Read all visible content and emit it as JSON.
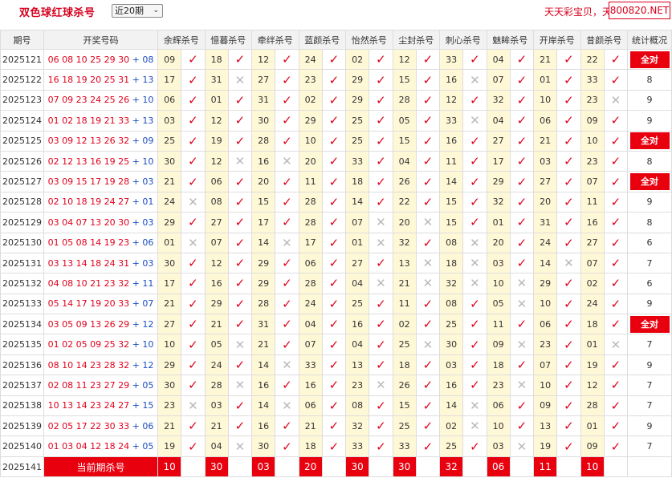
{
  "header": {
    "title": "双色球红球杀号",
    "range_select": "近20期",
    "promo_text": "天天彩宝贝，天",
    "site_badge": "800820.NET"
  },
  "columns": {
    "issue": "期号",
    "draw": "开奖号码",
    "experts": [
      "余辉杀号",
      "憶暮杀号",
      "牵绊杀号",
      "蓝颜杀号",
      "怡然杀号",
      "尘封杀号",
      "刺心杀号",
      "魅眸杀号",
      "开岸杀号",
      "昔颜杀号"
    ],
    "stat": "统计概况"
  },
  "marks": {
    "hit": "✓",
    "miss": "✕"
  },
  "rows": [
    {
      "issue": "2025121",
      "reds": "06 08 10 25 29 30",
      "blue": "08",
      "kills": [
        "09",
        "18",
        "12",
        "24",
        "02",
        "12",
        "33",
        "04",
        "21",
        "22"
      ],
      "hits": [
        1,
        1,
        1,
        1,
        1,
        1,
        1,
        1,
        1,
        1
      ],
      "stat": "全对"
    },
    {
      "issue": "2025122",
      "reds": "16 18 19 20 25 31",
      "blue": "13",
      "kills": [
        "17",
        "31",
        "27",
        "23",
        "29",
        "15",
        "16",
        "07",
        "01",
        "33"
      ],
      "hits": [
        1,
        0,
        1,
        1,
        1,
        1,
        0,
        1,
        1,
        1
      ],
      "stat": "8"
    },
    {
      "issue": "2025123",
      "reds": "07 09 23 24 25 26",
      "blue": "10",
      "kills": [
        "06",
        "01",
        "31",
        "02",
        "29",
        "28",
        "12",
        "32",
        "10",
        "23"
      ],
      "hits": [
        1,
        1,
        1,
        1,
        1,
        1,
        1,
        1,
        1,
        0
      ],
      "stat": "9"
    },
    {
      "issue": "2025124",
      "reds": "01 02 18 19 21 33",
      "blue": "13",
      "kills": [
        "03",
        "12",
        "30",
        "29",
        "25",
        "05",
        "33",
        "04",
        "06",
        "09"
      ],
      "hits": [
        1,
        1,
        1,
        1,
        1,
        1,
        0,
        1,
        1,
        1
      ],
      "stat": "9"
    },
    {
      "issue": "2025125",
      "reds": "03 09 12 13 26 32",
      "blue": "09",
      "kills": [
        "25",
        "19",
        "28",
        "10",
        "25",
        "15",
        "16",
        "27",
        "21",
        "10"
      ],
      "hits": [
        1,
        1,
        1,
        1,
        1,
        1,
        1,
        1,
        1,
        1
      ],
      "stat": "全对"
    },
    {
      "issue": "2025126",
      "reds": "02 12 13 16 19 25",
      "blue": "10",
      "kills": [
        "30",
        "12",
        "16",
        "20",
        "33",
        "04",
        "11",
        "17",
        "03",
        "23"
      ],
      "hits": [
        1,
        0,
        0,
        1,
        1,
        1,
        1,
        1,
        1,
        1
      ],
      "stat": "8"
    },
    {
      "issue": "2025127",
      "reds": "03 09 15 17 19 28",
      "blue": "03",
      "kills": [
        "21",
        "06",
        "20",
        "11",
        "18",
        "26",
        "14",
        "29",
        "27",
        "07"
      ],
      "hits": [
        1,
        1,
        1,
        1,
        1,
        1,
        1,
        1,
        1,
        1
      ],
      "stat": "全对"
    },
    {
      "issue": "2025128",
      "reds": "02 10 18 19 24 27",
      "blue": "01",
      "kills": [
        "24",
        "08",
        "15",
        "28",
        "14",
        "22",
        "15",
        "32",
        "20",
        "11"
      ],
      "hits": [
        0,
        1,
        1,
        1,
        1,
        1,
        1,
        1,
        1,
        1
      ],
      "stat": "9"
    },
    {
      "issue": "2025129",
      "reds": "03 04 07 13 20 30",
      "blue": "03",
      "kills": [
        "29",
        "27",
        "17",
        "28",
        "07",
        "20",
        "15",
        "01",
        "31",
        "16"
      ],
      "hits": [
        1,
        1,
        1,
        1,
        0,
        0,
        1,
        1,
        1,
        1
      ],
      "stat": "8"
    },
    {
      "issue": "2025130",
      "reds": "01 05 08 14 19 23",
      "blue": "06",
      "kills": [
        "01",
        "07",
        "14",
        "17",
        "01",
        "32",
        "08",
        "20",
        "24",
        "27"
      ],
      "hits": [
        0,
        1,
        0,
        1,
        0,
        1,
        0,
        1,
        1,
        1
      ],
      "stat": "6"
    },
    {
      "issue": "2025131",
      "reds": "03 13 14 18 24 31",
      "blue": "03",
      "kills": [
        "30",
        "12",
        "29",
        "06",
        "27",
        "13",
        "18",
        "03",
        "14",
        "07"
      ],
      "hits": [
        1,
        1,
        1,
        1,
        1,
        0,
        0,
        1,
        0,
        1
      ],
      "stat": "7"
    },
    {
      "issue": "2025132",
      "reds": "04 08 10 21 23 32",
      "blue": "11",
      "kills": [
        "17",
        "16",
        "29",
        "28",
        "04",
        "21",
        "32",
        "10",
        "29",
        "02"
      ],
      "hits": [
        1,
        1,
        1,
        1,
        0,
        0,
        0,
        0,
        1,
        1
      ],
      "stat": "6"
    },
    {
      "issue": "2025133",
      "reds": "05 14 17 19 20 33",
      "blue": "07",
      "kills": [
        "21",
        "29",
        "28",
        "24",
        "25",
        "11",
        "08",
        "05",
        "10",
        "24"
      ],
      "hits": [
        1,
        1,
        1,
        1,
        1,
        1,
        1,
        0,
        1,
        1
      ],
      "stat": "9"
    },
    {
      "issue": "2025134",
      "reds": "03 05 09 13 26 29",
      "blue": "12",
      "kills": [
        "27",
        "21",
        "31",
        "04",
        "16",
        "02",
        "25",
        "11",
        "06",
        "18"
      ],
      "hits": [
        1,
        1,
        1,
        1,
        1,
        1,
        1,
        1,
        1,
        1
      ],
      "stat": "全对"
    },
    {
      "issue": "2025135",
      "reds": "01 02 05 09 25 32",
      "blue": "10",
      "kills": [
        "10",
        "05",
        "21",
        "07",
        "04",
        "25",
        "30",
        "09",
        "23",
        "01"
      ],
      "hits": [
        1,
        0,
        1,
        1,
        1,
        0,
        1,
        0,
        1,
        0
      ],
      "stat": "7"
    },
    {
      "issue": "2025136",
      "reds": "08 10 14 23 28 32",
      "blue": "12",
      "kills": [
        "29",
        "24",
        "14",
        "33",
        "13",
        "18",
        "03",
        "18",
        "07",
        "19"
      ],
      "hits": [
        1,
        1,
        0,
        1,
        1,
        1,
        1,
        1,
        1,
        1
      ],
      "stat": "9"
    },
    {
      "issue": "2025137",
      "reds": "02 08 11 23 27 29",
      "blue": "05",
      "kills": [
        "30",
        "28",
        "16",
        "16",
        "23",
        "26",
        "16",
        "23",
        "10",
        "12"
      ],
      "hits": [
        1,
        0,
        1,
        1,
        0,
        1,
        1,
        0,
        1,
        1
      ],
      "stat": "7"
    },
    {
      "issue": "2025138",
      "reds": "10 13 14 23 24 27",
      "blue": "15",
      "kills": [
        "23",
        "03",
        "14",
        "06",
        "08",
        "15",
        "14",
        "06",
        "09",
        "28"
      ],
      "hits": [
        0,
        1,
        0,
        1,
        1,
        1,
        0,
        1,
        1,
        1
      ],
      "stat": "7"
    },
    {
      "issue": "2025139",
      "reds": "02 05 17 22 30 33",
      "blue": "06",
      "kills": [
        "21",
        "21",
        "16",
        "21",
        "32",
        "25",
        "02",
        "10",
        "13",
        "01"
      ],
      "hits": [
        1,
        1,
        1,
        1,
        1,
        1,
        0,
        1,
        1,
        1
      ],
      "stat": "9"
    },
    {
      "issue": "2025140",
      "reds": "01 03 04 12 18 24",
      "blue": "05",
      "kills": [
        "19",
        "04",
        "30",
        "18",
        "33",
        "33",
        "25",
        "03",
        "19",
        "09"
      ],
      "hits": [
        1,
        0,
        1,
        1,
        1,
        1,
        1,
        0,
        1,
        1
      ],
      "stat": "7"
    }
  ],
  "current": {
    "issue": "2025141",
    "label": "当前期杀号",
    "kills": [
      "10",
      "30",
      "03",
      "20",
      "30",
      "30",
      "32",
      "06",
      "11",
      "10"
    ]
  }
}
